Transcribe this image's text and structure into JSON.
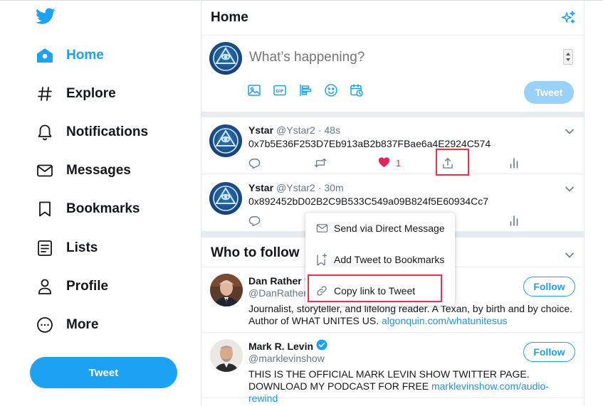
{
  "sidebar": {
    "logo": "twitter-bird-icon",
    "items": [
      {
        "label": "Home",
        "icon": "home-icon",
        "active": true
      },
      {
        "label": "Explore",
        "icon": "hashtag-icon",
        "active": false
      },
      {
        "label": "Notifications",
        "icon": "bell-icon",
        "active": false
      },
      {
        "label": "Messages",
        "icon": "envelope-icon",
        "active": false
      },
      {
        "label": "Bookmarks",
        "icon": "bookmark-icon",
        "active": false
      },
      {
        "label": "Lists",
        "icon": "list-icon",
        "active": false
      },
      {
        "label": "Profile",
        "icon": "person-icon",
        "active": false
      },
      {
        "label": "More",
        "icon": "more-circle-icon",
        "active": false
      }
    ],
    "tweet_button": "Tweet"
  },
  "header": {
    "title": "Home",
    "icon": "sparkle-icon"
  },
  "composer": {
    "placeholder": "What’s happening?",
    "tools": [
      "image-icon",
      "gif-icon",
      "poll-icon",
      "emoji-icon",
      "schedule-icon"
    ],
    "tweet_button": "Tweet"
  },
  "tweets": [
    {
      "name": "Ystar",
      "handle": "@Ystar2",
      "dot": "·",
      "time": "48s",
      "text": "0x7b5E36F253D7Eb913aB2b837FBae6a4E2924C574",
      "likes": "1"
    },
    {
      "name": "Ystar",
      "handle": "@Ystar2",
      "dot": "·",
      "time": "30m",
      "text": "0x892452bD02B2C9B533C549a09B824f5E60934Cc7",
      "likes": ""
    }
  ],
  "share_menu": {
    "items": [
      {
        "label": "Send via Direct Message",
        "icon": "envelope-icon"
      },
      {
        "label": "Add Tweet to Bookmarks",
        "icon": "bookmark-add-icon"
      },
      {
        "label": "Copy link to Tweet",
        "icon": "link-icon"
      }
    ]
  },
  "who_to_follow": {
    "title": "Who to follow",
    "users": [
      {
        "name": "Dan Rather",
        "handle": "@DanRather",
        "verified": true,
        "bio": "Journalist, storyteller, and lifelong reader. A Texan, by birth and by choice. Author of WHAT UNITES US.",
        "link": "algonquin.com/whatunitesus",
        "follow": "Follow"
      },
      {
        "name": "Mark R. Levin",
        "handle": "@marklevinshow",
        "verified": true,
        "bio": "THIS IS THE OFFICIAL MARK LEVIN SHOW TWITTER PAGE. DOWNLOAD MY PODCAST FOR FREE",
        "link": "marklevinshow.com/audio-rewind",
        "follow": "Follow"
      }
    ]
  },
  "colors": {
    "accent": "#1da1f2",
    "like": "#e0245e",
    "highlight_box": "#e8334a",
    "divider": "#e6ecf0"
  }
}
